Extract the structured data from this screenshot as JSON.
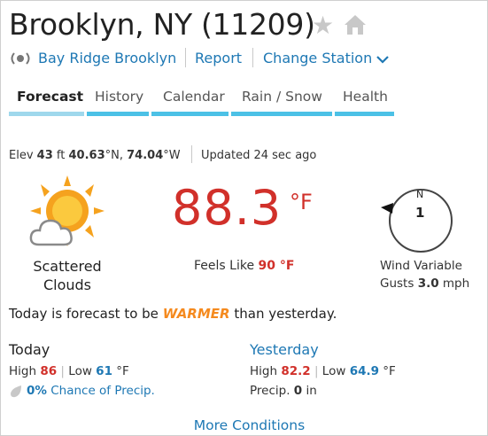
{
  "header": {
    "city": "Brooklyn, NY",
    "zip": "(11209)",
    "station": "Bay Ridge Brooklyn",
    "report_label": "Report",
    "change_station_label": "Change Station"
  },
  "tabs": [
    {
      "label": "Forecast",
      "active": true
    },
    {
      "label": "History",
      "active": false
    },
    {
      "label": "Calendar",
      "active": false
    },
    {
      "label": "Rain / Snow",
      "active": false
    },
    {
      "label": "Health",
      "active": false
    }
  ],
  "info": {
    "elev_label": "Elev",
    "elev_value": "43",
    "elev_unit": "ft",
    "lat": "40.63",
    "lat_dir": "°N,",
    "lon": "74.04",
    "lon_dir": "°W",
    "updated_label": "Updated",
    "updated_value": "24 sec ago"
  },
  "current": {
    "condition_line1": "Scattered",
    "condition_line2": "Clouds",
    "condition_icon": "partly-cloudy-icon",
    "temperature": "88.3",
    "temp_unit": "°F",
    "feels_like_label": "Feels Like",
    "feels_like_value": "90 °F",
    "wind_direction": "N",
    "wind_speed": "1",
    "wind_label": "Wind Variable",
    "gusts_label": "Gusts",
    "gusts_value": "3.0",
    "gusts_unit": "mph"
  },
  "forecast_sentence": {
    "prefix": "Today is forecast to be",
    "highlight": "WARMER",
    "suffix": "than yesterday."
  },
  "today": {
    "title": "Today",
    "high_label": "High",
    "high_value": "86",
    "low_label": "Low",
    "low_value": "61",
    "unit": "°F",
    "precip_value": "0%",
    "precip_label": "Chance of Precip."
  },
  "yesterday": {
    "title": "Yesterday",
    "high_label": "High",
    "high_value": "82.2",
    "low_label": "Low",
    "low_value": "64.9",
    "unit": "°F",
    "precip_label": "Precip.",
    "precip_value": "0",
    "precip_unit": "in"
  },
  "footer": {
    "more_conditions_label": "More Conditions"
  },
  "colors": {
    "link": "#1e78b4",
    "temperature": "#d1302a",
    "tab_bar": "#4cc1e6",
    "highlight": "#f58a1e"
  }
}
